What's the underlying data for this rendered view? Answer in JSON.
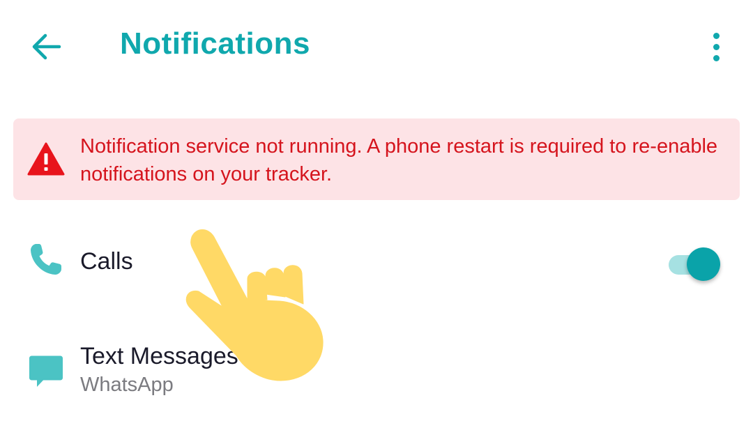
{
  "header": {
    "title": "Notifications",
    "back_icon": "arrow-left-icon",
    "more_icon": "more-vertical-icon"
  },
  "alert": {
    "icon": "warning-triangle-icon",
    "message": "Notification service not running. A phone restart is required to re-enable notifications on your tracker."
  },
  "settings": {
    "calls": {
      "icon": "phone-icon",
      "label": "Calls",
      "toggle_on": true
    },
    "text_messages": {
      "icon": "chat-bubble-icon",
      "label": "Text Messages",
      "sublabel": "WhatsApp"
    }
  },
  "colors": {
    "accent": "#10a8ad",
    "alert_background": "#fde3e6",
    "alert_text": "#d5141d",
    "icon_teal": "#4bc3c4",
    "hand": "#ffd966"
  }
}
